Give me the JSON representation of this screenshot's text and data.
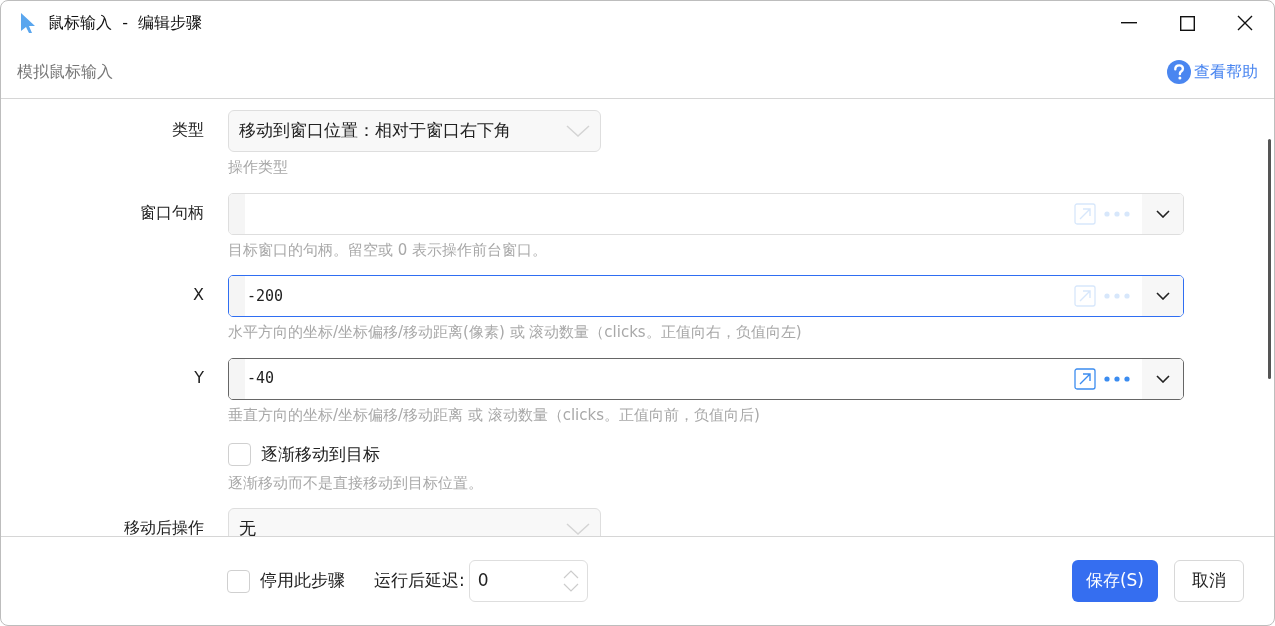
{
  "window": {
    "title": "鼠标输入  -  编辑步骤"
  },
  "header": {
    "subtitle": "模拟鼠标输入",
    "help_link": "查看帮助"
  },
  "fields": [
    {
      "kind": "select",
      "label": "类型",
      "value": "移动到窗口位置：相对于窗口右下角",
      "hint": "操作类型"
    },
    {
      "kind": "text",
      "label": "窗口句柄",
      "focused": false,
      "hovered": false,
      "hint": "目标窗口的句柄。留空或 0 表示操作前台窗口。"
    },
    {
      "kind": "text",
      "label": "X",
      "value": "-200",
      "focused": true,
      "hovered": false,
      "hint": "水平方向的坐标/坐标偏移/移动距离(像素) 或 滚动数量（clicks。正值向右，负值向左)"
    },
    {
      "kind": "text",
      "label": "Y",
      "value": "-40",
      "focused": false,
      "hovered": true,
      "hint": "垂直方向的坐标/坐标偏移/移动距离 或 滚动数量（clicks。正值向前，负值向后)"
    },
    {
      "kind": "checkbox",
      "text": "逐渐移动到目标",
      "checked": false,
      "hint": "逐渐移动而不是直接移动到目标位置。"
    },
    {
      "kind": "select",
      "label": "移动后操作",
      "value": "无"
    }
  ],
  "footer": {
    "disable_step": {
      "text": "停用此步骤",
      "checked": false
    },
    "delay_label": "运行后延迟:",
    "delay_value": "0",
    "buttons": [
      {
        "label": "保存(S)",
        "kind": "primary"
      },
      {
        "label": "取消",
        "kind": "secondary"
      }
    ]
  }
}
